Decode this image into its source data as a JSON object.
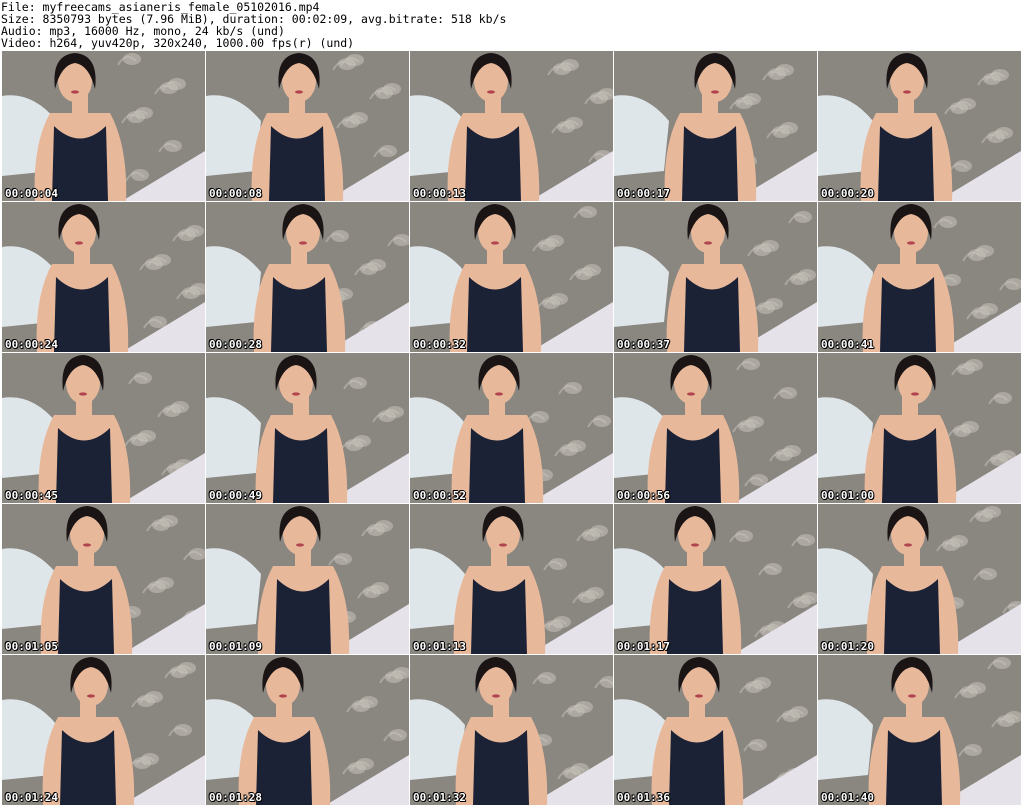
{
  "header": {
    "file": "File: myfreecams_asianeris_female_05102016.mp4",
    "size": "Size: 8350793 bytes (7.96 MiB), duration: 00:02:09, avg.bitrate: 518 kb/s",
    "audio": "Audio: mp3, 16000 Hz, mono, 24 kb/s (und)",
    "video": "Video: h264, yuv420p, 320x240, 1000.00 fps(r) (und)"
  },
  "thumbnails": [
    {
      "time": "00:00:04"
    },
    {
      "time": "00:00:08"
    },
    {
      "time": "00:00:13"
    },
    {
      "time": "00:00:17"
    },
    {
      "time": "00:00:20"
    },
    {
      "time": "00:00:24"
    },
    {
      "time": "00:00:28"
    },
    {
      "time": "00:00:32"
    },
    {
      "time": "00:00:37"
    },
    {
      "time": "00:00:41"
    },
    {
      "time": "00:00:45"
    },
    {
      "time": "00:00:49"
    },
    {
      "time": "00:00:52"
    },
    {
      "time": "00:00:56"
    },
    {
      "time": "00:01:00"
    },
    {
      "time": "00:01:05"
    },
    {
      "time": "00:01:09"
    },
    {
      "time": "00:01:13"
    },
    {
      "time": "00:01:17"
    },
    {
      "time": "00:01:20"
    },
    {
      "time": "00:01:24"
    },
    {
      "time": "00:01:28"
    },
    {
      "time": "00:01:32"
    },
    {
      "time": "00:01:36"
    },
    {
      "time": "00:01:40"
    }
  ],
  "colors": {
    "wallpaper": "#8a8680",
    "wallpaper_pattern": "#c9c4bc",
    "pillow": "#dfe6ea",
    "table": "#e6e2ea",
    "skin": "#e8b89a",
    "top": "#1c2236",
    "hair": "#1a1414",
    "timestamp": "#ffffff"
  }
}
